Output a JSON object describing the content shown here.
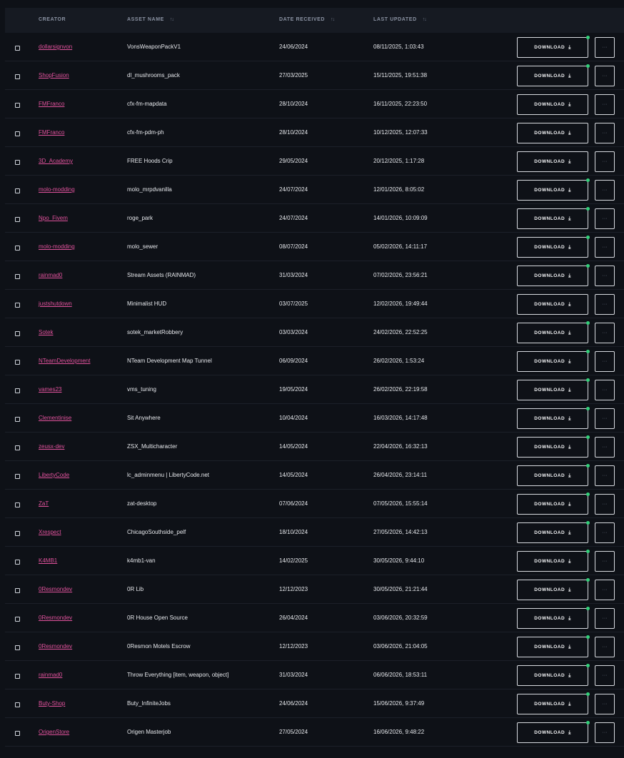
{
  "header": {
    "creator": "CREATOR",
    "asset_name": "ASSET NAME",
    "date_received": "DATE RECEIVED",
    "last_updated": "LAST UPDATED",
    "sort_icon": "sort-icon"
  },
  "actions": {
    "download_label": "DOWNLOAD",
    "download_icon": "download-icon",
    "more_label": "···"
  },
  "colors": {
    "creator_link": "#e0529c",
    "status_dot": "#33d17a",
    "background": "#0e1117"
  },
  "rows": [
    {
      "creator": "dollarsignvon",
      "asset": "VonsWeaponPackV1",
      "received": "24/06/2024",
      "updated": "08/11/2025, 1:03:43",
      "dot": true
    },
    {
      "creator": "ShopFusion",
      "asset": "dl_mushrooms_pack",
      "received": "27/03/2025",
      "updated": "15/11/2025, 19:51:38",
      "dot": true
    },
    {
      "creator": "FMFranco",
      "asset": "cfx-fm-mapdata",
      "received": "28/10/2024",
      "updated": "16/11/2025, 22:23:50",
      "dot": false
    },
    {
      "creator": "FMFranco",
      "asset": "cfx-fm-pdm-ph",
      "received": "28/10/2024",
      "updated": "10/12/2025, 12:07:33",
      "dot": false
    },
    {
      "creator": "3D_Academy",
      "asset": "FREE Hoods Crip",
      "received": "29/05/2024",
      "updated": "20/12/2025, 1:17:28",
      "dot": false
    },
    {
      "creator": "molo-modding",
      "asset": "molo_mrpdvanilla",
      "received": "24/07/2024",
      "updated": "12/01/2026, 8:05:02",
      "dot": true
    },
    {
      "creator": "Npo_Fivem",
      "asset": "roge_park",
      "received": "24/07/2024",
      "updated": "14/01/2026, 10:09:09",
      "dot": true
    },
    {
      "creator": "molo-modding",
      "asset": "molo_sewer",
      "received": "08/07/2024",
      "updated": "05/02/2026, 14:11:17",
      "dot": true
    },
    {
      "creator": "rainmad0",
      "asset": "Stream Assets (RAINMAD)",
      "received": "31/03/2024",
      "updated": "07/02/2026, 23:56:21",
      "dot": true
    },
    {
      "creator": "justshutdown",
      "asset": "Minimalist HUD",
      "received": "03/07/2025",
      "updated": "12/02/2026, 19:49:44",
      "dot": false
    },
    {
      "creator": "Sotek",
      "asset": "sotek_marketRobbery",
      "received": "03/03/2024",
      "updated": "24/02/2026, 22:52:25",
      "dot": true
    },
    {
      "creator": "NTeamDevelopment",
      "asset": "NTeam Development Map Tunnel",
      "received": "06/09/2024",
      "updated": "26/02/2026, 1:53:24",
      "dot": true
    },
    {
      "creator": "vames23",
      "asset": "vms_tuning",
      "received": "19/05/2024",
      "updated": "26/02/2026, 22:19:58",
      "dot": true
    },
    {
      "creator": "Clementinise",
      "asset": "Sit Anywhere",
      "received": "10/04/2024",
      "updated": "16/03/2026, 14:17:48",
      "dot": true
    },
    {
      "creator": "zeusx-dev",
      "asset": "ZSX_Multicharacter",
      "received": "14/05/2024",
      "updated": "22/04/2026, 16:32:13",
      "dot": true
    },
    {
      "creator": "LibertyCode",
      "asset": "lc_adminmenu | LibertyCode.net",
      "received": "14/05/2024",
      "updated": "26/04/2026, 23:14:11",
      "dot": true
    },
    {
      "creator": "ZaT",
      "asset": "zat-desktop",
      "received": "07/06/2024",
      "updated": "07/05/2026, 15:55:14",
      "dot": true
    },
    {
      "creator": "Xrespect",
      "asset": "ChicagoSouthside_pelf",
      "received": "18/10/2024",
      "updated": "27/05/2026, 14:42:13",
      "dot": true
    },
    {
      "creator": "K4MB1",
      "asset": "k4mb1-van",
      "received": "14/02/2025",
      "updated": "30/05/2026, 9:44:10",
      "dot": true
    },
    {
      "creator": "0Resmondev",
      "asset": "0R Lib",
      "received": "12/12/2023",
      "updated": "30/05/2026, 21:21:44",
      "dot": true
    },
    {
      "creator": "0Resmondev",
      "asset": "0R House Open Source",
      "received": "26/04/2024",
      "updated": "03/06/2026, 20:32:59",
      "dot": true
    },
    {
      "creator": "0Resmondev",
      "asset": "0Resmon Motels Escrow",
      "received": "12/12/2023",
      "updated": "03/06/2026, 21:04:05",
      "dot": true
    },
    {
      "creator": "rainmad0",
      "asset": "Throw Everything [item, weapon, object]",
      "received": "31/03/2024",
      "updated": "06/06/2026, 18:53:11",
      "dot": true
    },
    {
      "creator": "Buty-Shop",
      "asset": "Buty_InfiniteJobs",
      "received": "24/06/2024",
      "updated": "15/06/2026, 9:37:49",
      "dot": true
    },
    {
      "creator": "OrigenStore",
      "asset": "Origen Masterjob",
      "received": "27/05/2024",
      "updated": "16/06/2026, 9:48:22",
      "dot": true
    }
  ]
}
